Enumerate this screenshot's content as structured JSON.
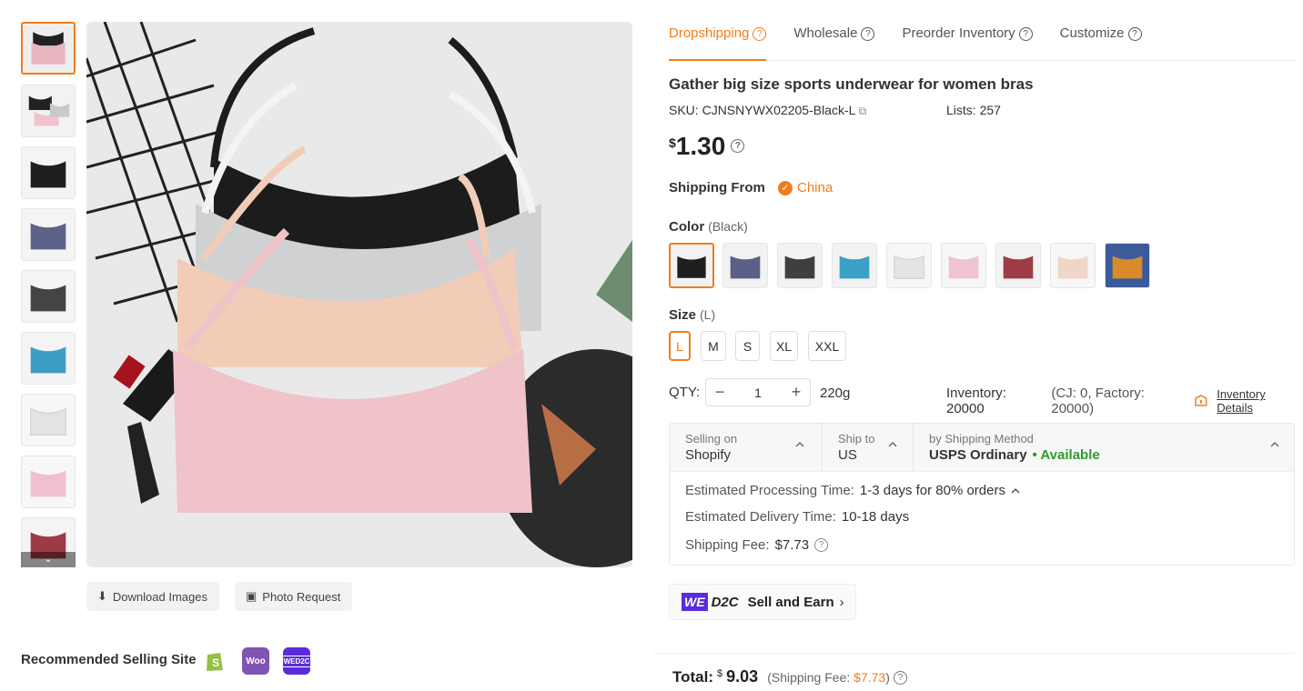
{
  "gallery": {
    "thumbnails": [
      {
        "name": "pink-black-set",
        "color": "#e9b6c0"
      },
      {
        "name": "grey-pink-set",
        "color": "#d9d9d9"
      },
      {
        "name": "black",
        "color": "#222222"
      },
      {
        "name": "navy",
        "color": "#5c6288"
      },
      {
        "name": "charcoal",
        "color": "#444444"
      },
      {
        "name": "blue",
        "color": "#3d9ec5"
      },
      {
        "name": "white",
        "color": "#e8e8e8"
      },
      {
        "name": "pink",
        "color": "#efc0cf"
      },
      {
        "name": "wine",
        "color": "#9c3a45"
      }
    ],
    "download_label": "Download Images",
    "photo_request_label": "Photo Request"
  },
  "recommended": {
    "label": "Recommended Selling Site",
    "sites": [
      "shopify-icon",
      "woocommerce-icon",
      "wed2c-icon"
    ]
  },
  "tabs": [
    {
      "label": "Dropshipping",
      "active": true
    },
    {
      "label": "Wholesale",
      "active": false
    },
    {
      "label": "Preorder Inventory",
      "active": false
    },
    {
      "label": "Customize",
      "active": false
    }
  ],
  "product": {
    "title": "Gather big size sports underwear for women bras",
    "sku_label": "SKU:",
    "sku": "CJNSNYWX02205-Black-L",
    "lists_label": "Lists:",
    "lists": "257",
    "currency": "$",
    "price": "1.30"
  },
  "shipping_from": {
    "label": "Shipping From",
    "value": "China"
  },
  "color": {
    "label": "Color",
    "selected": "(Black)",
    "options": [
      {
        "name": "black",
        "hex": "#1f1f1f"
      },
      {
        "name": "navy",
        "hex": "#5b6088"
      },
      {
        "name": "charcoal",
        "hex": "#3f3f3f"
      },
      {
        "name": "blue",
        "hex": "#3aa0c6"
      },
      {
        "name": "white",
        "hex": "#ececec"
      },
      {
        "name": "pink",
        "hex": "#f0c3d1"
      },
      {
        "name": "wine",
        "hex": "#9e3b47"
      },
      {
        "name": "beige",
        "hex": "#efd6c7"
      },
      {
        "name": "orange",
        "hex": "#d98a2a"
      }
    ]
  },
  "size": {
    "label": "Size",
    "selected": "(L)",
    "options": [
      "L",
      "M",
      "S",
      "XL",
      "XXL"
    ]
  },
  "qty": {
    "label": "QTY:",
    "value": "1",
    "minus": "−",
    "plus": "+",
    "weight": "220g",
    "inventory_label": "Inventory: 20000",
    "inventory_breakdown": "(CJ: 0, Factory: 20000)",
    "inventory_link": "Inventory Details"
  },
  "shipping": {
    "selling_on_label": "Selling on",
    "selling_on": "Shopify",
    "ship_to_label": "Ship to",
    "ship_to": "US",
    "method_label": "by Shipping Method",
    "method": "USPS Ordinary",
    "availability": "• Available",
    "processing_label": "Estimated Processing Time:",
    "processing": "1-3 days for 80% orders",
    "delivery_label": "Estimated Delivery Time:",
    "delivery": "10-18 days",
    "fee_label": "Shipping Fee:",
    "fee": "$7.73"
  },
  "d2c": {
    "we": "WE",
    "d2c": "D2C",
    "label": "Sell and Earn",
    "chevron": "›"
  },
  "total": {
    "label": "Total:",
    "currency": "$",
    "amount": "9.03",
    "fee_prefix": "(Shipping Fee: ",
    "fee": "$7.73",
    "fee_suffix": ")"
  },
  "colors": {
    "accent": "#f07d1a",
    "available": "#2e9b2e",
    "d2c": "#5a2bdc"
  }
}
